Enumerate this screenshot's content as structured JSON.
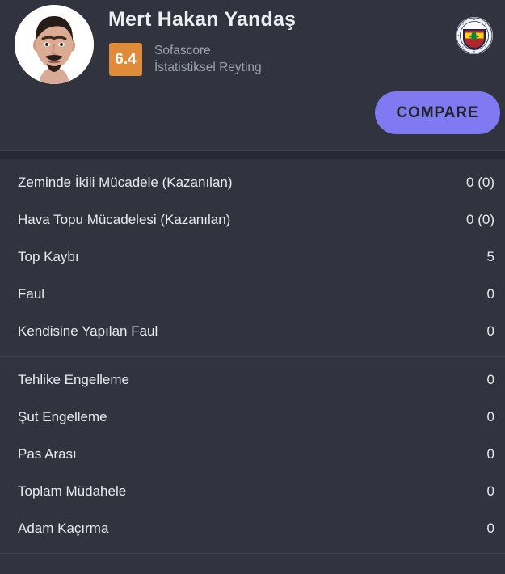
{
  "header": {
    "player_name": "Mert Hakan Yandaş",
    "rating_value": "6.4",
    "rating_label_line1": "Sofascore",
    "rating_label_line2": "İstatistiksel Reyting",
    "compare_label": "COMPARE",
    "avatar_name": "player-avatar",
    "team_logo_name": "fenerbahce-logo",
    "colors": {
      "background": "#31343f",
      "rating_badge": "#e08b3a",
      "compare_button": "#7f79f2",
      "compare_text": "#21232d",
      "primary_text": "#e8eaef",
      "secondary_text": "#9da2ae",
      "divider": "#3f4354",
      "band": "#272a35"
    }
  },
  "stats": {
    "groups": [
      {
        "rows": [
          {
            "label": "Zeminde İkili Mücadele (Kazanılan)",
            "value": "0 (0)"
          },
          {
            "label": "Hava Topu Mücadelesi (Kazanılan)",
            "value": "0 (0)"
          },
          {
            "label": "Top Kaybı",
            "value": "5"
          },
          {
            "label": "Faul",
            "value": "0"
          },
          {
            "label": "Kendisine Yapılan Faul",
            "value": "0"
          }
        ]
      },
      {
        "rows": [
          {
            "label": "Tehlike Engelleme",
            "value": "0"
          },
          {
            "label": "Şut Engelleme",
            "value": "0"
          },
          {
            "label": "Pas Arası",
            "value": "0"
          },
          {
            "label": "Toplam Müdahele",
            "value": "0"
          },
          {
            "label": "Adam Kaçırma",
            "value": "0"
          }
        ]
      }
    ]
  }
}
